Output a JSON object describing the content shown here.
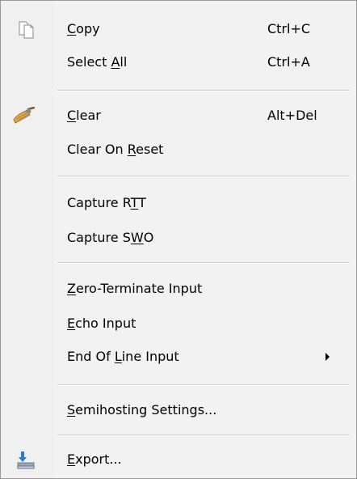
{
  "menu": {
    "items": [
      {
        "id": "copy",
        "pre": "",
        "u": "C",
        "post": "opy",
        "shortcut": "Ctrl+C",
        "icon": "copy-icon"
      },
      {
        "id": "select-all",
        "pre": "Select ",
        "u": "A",
        "post": "ll",
        "shortcut": "Ctrl+A"
      },
      {
        "id": "clear",
        "pre": "",
        "u": "C",
        "post": "lear",
        "shortcut": "Alt+Del",
        "icon": "broom-icon"
      },
      {
        "id": "clear-on-reset",
        "pre": "Clear On ",
        "u": "R",
        "post": "eset",
        "shortcut": ""
      },
      {
        "id": "capture-rtt",
        "pre": "Capture R",
        "u": "T",
        "post": "T",
        "shortcut": ""
      },
      {
        "id": "capture-swo",
        "pre": "Capture S",
        "u": "W",
        "post": "O",
        "shortcut": ""
      },
      {
        "id": "zero-terminate-input",
        "pre": "",
        "u": "Z",
        "post": "ero-Terminate Input",
        "shortcut": ""
      },
      {
        "id": "echo-input",
        "pre": "",
        "u": "E",
        "post": "cho Input",
        "shortcut": ""
      },
      {
        "id": "end-of-line-input",
        "pre": "End Of ",
        "u": "L",
        "post": "ine Input",
        "shortcut": "",
        "submenu": true
      },
      {
        "id": "semihosting-settings",
        "pre": "",
        "u": "S",
        "post": "emihosting Settings...",
        "shortcut": ""
      },
      {
        "id": "export",
        "pre": "",
        "u": "E",
        "post": "xport...",
        "shortcut": "",
        "icon": "export-icon"
      }
    ],
    "colors": {
      "background": "#f2f2f2",
      "border": "#979797",
      "separator": "#cfcfcf"
    }
  }
}
